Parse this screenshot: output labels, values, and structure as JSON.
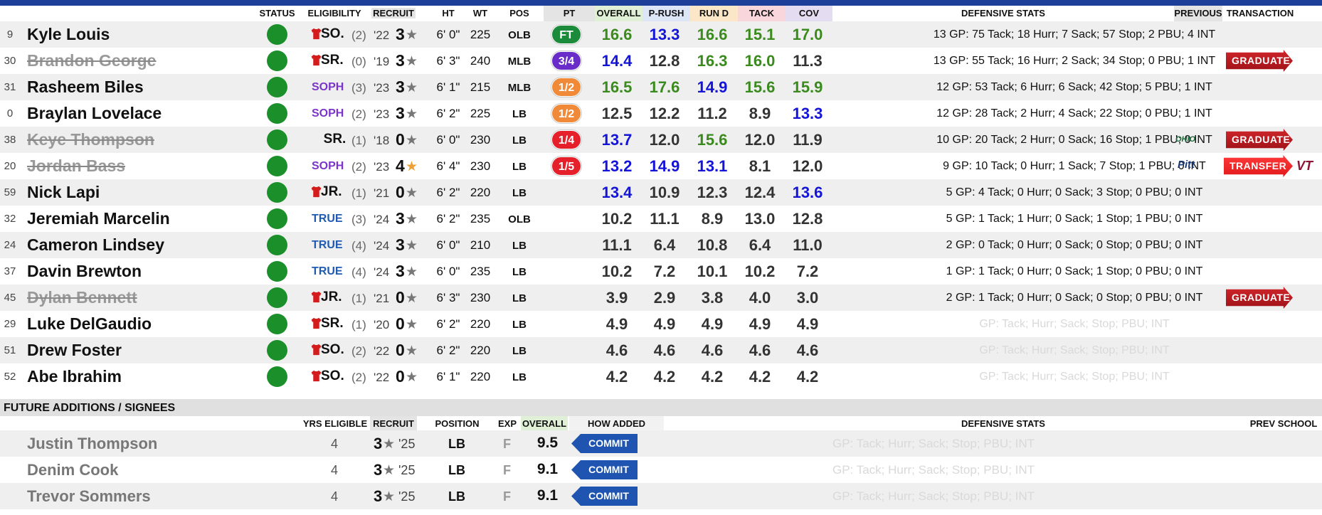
{
  "headers": {
    "status": "STATUS",
    "eligibility": "ELIGIBILITY",
    "recruit": "RECRUIT",
    "ht": "HT",
    "wt": "WT",
    "pos": "POS",
    "pt": "PT",
    "overall": "OVERALL",
    "prush": "P-RUSH",
    "rund": "RUN D",
    "tack": "TACK",
    "cov": "COV",
    "defensive_stats": "DEFENSIVE STATS",
    "previous": "PREVIOUS",
    "transaction": "TRANSACTION"
  },
  "colors": {
    "green": "#3a8a1e",
    "blue": "#1414d8",
    "dark": "#333333",
    "pt_ft": "#1b8a3a",
    "pt_34": "#6a2cc9",
    "pt_12": "#f08a38",
    "pt_14": "#e5202a",
    "pt_15": "#e5202a"
  },
  "players": [
    {
      "num": "9",
      "name": "Kyle Louis",
      "struck": false,
      "redshirt": true,
      "class": "SO.",
      "classStyle": "red",
      "group": "(2)",
      "year": "'22",
      "rec": "3",
      "gold": false,
      "ht": "6' 0\"",
      "wt": "225",
      "pos": "OLB",
      "pt": "FT",
      "ptColor": "#1b8a3a",
      "scores": [
        "16.6",
        "13.3",
        "16.6",
        "15.1",
        "17.0"
      ],
      "scoreColors": [
        "g",
        "b",
        "g",
        "g",
        "g"
      ],
      "stats": "13 GP: 75 Tack; 18 Hurr; 7 Sack; 57 Stop; 2 PBU; 4 INT",
      "ghost": false,
      "badge": "",
      "prev": ""
    },
    {
      "num": "30",
      "name": "Brandon George",
      "struck": true,
      "redshirt": true,
      "class": "SR.",
      "classStyle": "red",
      "group": "(0)",
      "year": "'19",
      "rec": "3",
      "gold": false,
      "ht": "6' 3\"",
      "wt": "240",
      "pos": "MLB",
      "pt": "3/4",
      "ptColor": "#6a2cc9",
      "scores": [
        "14.4",
        "12.8",
        "16.3",
        "16.0",
        "11.3"
      ],
      "scoreColors": [
        "b",
        "d",
        "g",
        "g",
        "d"
      ],
      "stats": "13 GP: 55 Tack; 16 Hurr; 2 Sack; 34 Stop; 0 PBU; 1 INT",
      "ghost": false,
      "badge": "GRADUATE",
      "prev": ""
    },
    {
      "num": "31",
      "name": "Rasheem Biles",
      "struck": false,
      "redshirt": false,
      "class": "SOPH",
      "classStyle": "soph",
      "group": "(3)",
      "year": "'23",
      "rec": "3",
      "gold": false,
      "ht": "6' 1\"",
      "wt": "215",
      "pos": "MLB",
      "pt": "1/2",
      "ptColor": "#f08a38",
      "scores": [
        "16.5",
        "17.6",
        "14.9",
        "15.6",
        "15.9"
      ],
      "scoreColors": [
        "g",
        "g",
        "b",
        "g",
        "g"
      ],
      "stats": "12 GP: 53 Tack; 6 Hurr; 6 Sack; 42 Stop; 5 PBU; 1 INT",
      "ghost": false,
      "badge": "",
      "prev": ""
    },
    {
      "num": "0",
      "name": "Braylan Lovelace",
      "struck": false,
      "redshirt": false,
      "class": "SOPH",
      "classStyle": "soph",
      "group": "(2)",
      "year": "'23",
      "rec": "3",
      "gold": false,
      "ht": "6' 2\"",
      "wt": "225",
      "pos": "LB",
      "pt": "1/2",
      "ptColor": "#f08a38",
      "scores": [
        "12.5",
        "12.2",
        "11.2",
        "8.9",
        "13.3"
      ],
      "scoreColors": [
        "d",
        "d",
        "d",
        "d",
        "b"
      ],
      "stats": "12 GP: 28 Tack; 2 Hurr; 4 Sack; 22 Stop; 0 PBU; 1 INT",
      "ghost": false,
      "badge": "",
      "prev": ""
    },
    {
      "num": "38",
      "name": "Keye Thompson",
      "struck": true,
      "redshirt": false,
      "class": "SR.",
      "classStyle": "plain",
      "group": "(1)",
      "year": "'18",
      "rec": "0",
      "gold": false,
      "ht": "6' 0\"",
      "wt": "230",
      "pos": "LB",
      "pt": "1/4",
      "ptColor": "#e5202a",
      "scores": [
        "13.7",
        "12.0",
        "15.6",
        "12.0",
        "11.9"
      ],
      "scoreColors": [
        "b",
        "d",
        "g",
        "d",
        "d"
      ],
      "stats": "10 GP: 20 Tack; 2 Hurr; 0 Sack; 16 Stop; 1 PBU; 0 INT",
      "ghost": false,
      "badge": "GRADUATE",
      "prev": "OHIO"
    },
    {
      "num": "20",
      "name": "Jordan Bass",
      "struck": true,
      "redshirt": false,
      "class": "SOPH",
      "classStyle": "soph",
      "group": "(2)",
      "year": "'23",
      "rec": "4",
      "gold": true,
      "ht": "6' 4\"",
      "wt": "230",
      "pos": "LB",
      "pt": "1/5",
      "ptColor": "#e5202a",
      "scores": [
        "13.2",
        "14.9",
        "13.1",
        "8.1",
        "12.0"
      ],
      "scoreColors": [
        "b",
        "b",
        "b",
        "d",
        "d"
      ],
      "stats": "9 GP: 10 Tack; 0 Hurr; 1 Sack; 7 Stop; 1 PBU; 0 INT",
      "ghost": false,
      "badge": "TRANSFER",
      "prev": "Pitt"
    },
    {
      "num": "59",
      "name": "Nick Lapi",
      "struck": false,
      "redshirt": true,
      "class": "JR.",
      "classStyle": "red",
      "group": "(1)",
      "year": "'21",
      "rec": "0",
      "gold": false,
      "ht": "6' 2\"",
      "wt": "220",
      "pos": "LB",
      "pt": "",
      "ptColor": "",
      "scores": [
        "13.4",
        "10.9",
        "12.3",
        "12.4",
        "13.6"
      ],
      "scoreColors": [
        "b",
        "d",
        "d",
        "d",
        "b"
      ],
      "stats": "5 GP: 4 Tack; 0 Hurr; 0 Sack; 3 Stop; 0 PBU; 0 INT",
      "ghost": false,
      "badge": "",
      "prev": ""
    },
    {
      "num": "32",
      "name": "Jeremiah Marcelin",
      "struck": false,
      "redshirt": false,
      "class": "TRUE",
      "classStyle": "true",
      "group": "(3)",
      "year": "'24",
      "rec": "3",
      "gold": false,
      "ht": "6' 2\"",
      "wt": "235",
      "pos": "OLB",
      "pt": "",
      "ptColor": "",
      "scores": [
        "10.2",
        "11.1",
        "8.9",
        "13.0",
        "12.8"
      ],
      "scoreColors": [
        "d",
        "d",
        "d",
        "d",
        "d"
      ],
      "stats": "5 GP: 1 Tack; 1 Hurr; 0 Sack; 1 Stop; 1 PBU; 0 INT",
      "ghost": false,
      "badge": "",
      "prev": ""
    },
    {
      "num": "24",
      "name": "Cameron Lindsey",
      "struck": false,
      "redshirt": false,
      "class": "TRUE",
      "classStyle": "true",
      "group": "(4)",
      "year": "'24",
      "rec": "3",
      "gold": false,
      "ht": "6' 0\"",
      "wt": "210",
      "pos": "LB",
      "pt": "",
      "ptColor": "",
      "scores": [
        "11.1",
        "6.4",
        "10.8",
        "6.4",
        "11.0"
      ],
      "scoreColors": [
        "d",
        "d",
        "d",
        "d",
        "d"
      ],
      "stats": "2 GP: 0 Tack; 0 Hurr; 0 Sack; 0 Stop; 0 PBU; 0 INT",
      "ghost": false,
      "badge": "",
      "prev": ""
    },
    {
      "num": "37",
      "name": "Davin Brewton",
      "struck": false,
      "redshirt": false,
      "class": "TRUE",
      "classStyle": "true",
      "group": "(4)",
      "year": "'24",
      "rec": "3",
      "gold": false,
      "ht": "6' 0\"",
      "wt": "235",
      "pos": "LB",
      "pt": "",
      "ptColor": "",
      "scores": [
        "10.2",
        "7.2",
        "10.1",
        "10.2",
        "7.2"
      ],
      "scoreColors": [
        "d",
        "d",
        "d",
        "d",
        "d"
      ],
      "stats": "1 GP: 1 Tack; 0 Hurr; 0 Sack; 1 Stop; 0 PBU; 0 INT",
      "ghost": false,
      "badge": "",
      "prev": ""
    },
    {
      "num": "45",
      "name": "Dylan Bennett",
      "struck": true,
      "redshirt": true,
      "class": "JR.",
      "classStyle": "red",
      "group": "(1)",
      "year": "'21",
      "rec": "0",
      "gold": false,
      "ht": "6' 3\"",
      "wt": "230",
      "pos": "LB",
      "pt": "",
      "ptColor": "",
      "scores": [
        "3.9",
        "2.9",
        "3.8",
        "4.0",
        "3.0"
      ],
      "scoreColors": [
        "d",
        "d",
        "d",
        "d",
        "d"
      ],
      "stats": "2 GP: 1 Tack; 0 Hurr; 0 Sack; 0 Stop; 0 PBU; 0 INT",
      "ghost": false,
      "badge": "GRADUATE",
      "prev": ""
    },
    {
      "num": "29",
      "name": "Luke DelGaudio",
      "struck": false,
      "redshirt": true,
      "class": "SR.",
      "classStyle": "red",
      "group": "(1)",
      "year": "'20",
      "rec": "0",
      "gold": false,
      "ht": "6' 2\"",
      "wt": "220",
      "pos": "LB",
      "pt": "",
      "ptColor": "",
      "scores": [
        "4.9",
        "4.9",
        "4.9",
        "4.9",
        "4.9"
      ],
      "scoreColors": [
        "d",
        "d",
        "d",
        "d",
        "d"
      ],
      "stats": "GP: Tack; Hurr; Sack; Stop; PBU; INT",
      "ghost": true,
      "badge": "",
      "prev": ""
    },
    {
      "num": "51",
      "name": "Drew Foster",
      "struck": false,
      "redshirt": true,
      "class": "SO.",
      "classStyle": "red",
      "group": "(2)",
      "year": "'22",
      "rec": "0",
      "gold": false,
      "ht": "6' 2\"",
      "wt": "220",
      "pos": "LB",
      "pt": "",
      "ptColor": "",
      "scores": [
        "4.6",
        "4.6",
        "4.6",
        "4.6",
        "4.6"
      ],
      "scoreColors": [
        "d",
        "d",
        "d",
        "d",
        "d"
      ],
      "stats": "GP: Tack; Hurr; Sack; Stop; PBU; INT",
      "ghost": true,
      "badge": "",
      "prev": ""
    },
    {
      "num": "52",
      "name": "Abe Ibrahim",
      "struck": false,
      "redshirt": true,
      "class": "SO.",
      "classStyle": "red",
      "group": "(2)",
      "year": "'22",
      "rec": "0",
      "gold": false,
      "ht": "6' 1\"",
      "wt": "220",
      "pos": "LB",
      "pt": "",
      "ptColor": "",
      "scores": [
        "4.2",
        "4.2",
        "4.2",
        "4.2",
        "4.2"
      ],
      "scoreColors": [
        "d",
        "d",
        "d",
        "d",
        "d"
      ],
      "stats": "GP: Tack; Hurr; Sack; Stop; PBU; INT",
      "ghost": true,
      "badge": "",
      "prev": ""
    }
  ],
  "transfer_destination": "VT",
  "future": {
    "section_title": "FUTURE ADDITIONS / SIGNEES",
    "headers": {
      "yrs": "YRS ELIGIBLE",
      "recruit": "RECRUIT",
      "position": "POSITION",
      "exp": "EXP",
      "overall": "OVERALL",
      "how": "HOW ADDED",
      "stats": "DEFENSIVE STATS",
      "prev": "PREV SCHOOL"
    },
    "signees": [
      {
        "name": "Justin Thompson",
        "yrs": "4",
        "rec": "3",
        "year": "'25",
        "pos": "LB",
        "exp": "F",
        "overall": "9.5",
        "how": "COMMIT",
        "stats": "GP: Tack; Hurr; Sack; Stop; PBU; INT"
      },
      {
        "name": "Denim Cook",
        "yrs": "4",
        "rec": "3",
        "year": "'25",
        "pos": "LB",
        "exp": "F",
        "overall": "9.1",
        "how": "COMMIT",
        "stats": "GP: Tack; Hurr; Sack; Stop; PBU; INT"
      },
      {
        "name": "Trevor Sommers",
        "yrs": "4",
        "rec": "3",
        "year": "'25",
        "pos": "LB",
        "exp": "F",
        "overall": "9.1",
        "how": "COMMIT",
        "stats": "GP: Tack; Hurr; Sack; Stop; PBU; INT"
      }
    ]
  }
}
